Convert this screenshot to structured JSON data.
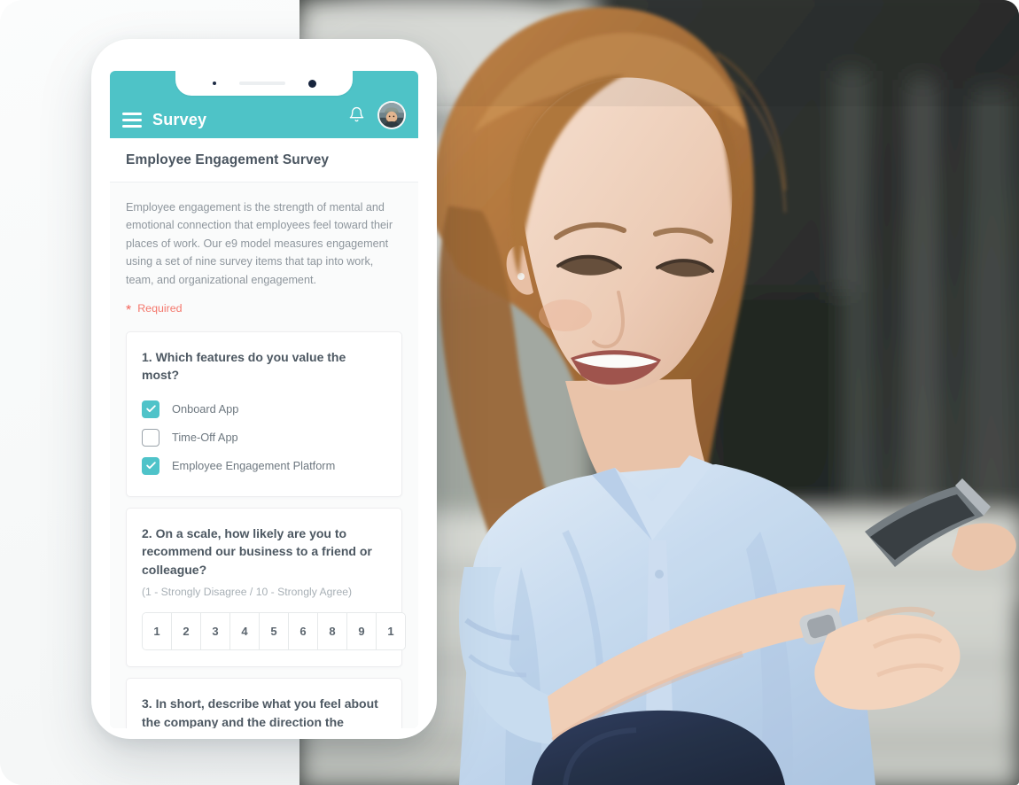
{
  "app": {
    "title": "Survey",
    "menu_icon": "hamburger-menu-icon",
    "notification_icon": "bell-icon",
    "avatar_label": "User avatar",
    "accent_color": "#4EC3C7",
    "required_color": "#F4776C"
  },
  "survey": {
    "title": "Employee Engagement Survey",
    "description": "Employee engagement is the strength of mental and emotional connection that employees feel toward their places of work. Our e9 model measures engagement using a set of nine survey items that tap into work, team, and organizational engagement.",
    "required_star": "*",
    "required_label": "Required"
  },
  "questions": [
    {
      "title": "1. Which features do you value the most?",
      "type": "checkbox",
      "options": [
        {
          "label": "Onboard App",
          "checked": true
        },
        {
          "label": "Time-Off App",
          "checked": false
        },
        {
          "label": "Employee Engagement Platform",
          "checked": true
        }
      ]
    },
    {
      "title": "2. On a scale, how likely are you to recommend our business to a friend or colleague?",
      "type": "scale",
      "hint": "(1 -  Strongly Disagree / 10 - Strongly Agree)",
      "scale_values": [
        "1",
        "2",
        "3",
        "4",
        "5",
        "6",
        "8",
        "9",
        "1"
      ]
    },
    {
      "title": "3. In short, describe what you feel about the company and the direction the",
      "type": "text"
    }
  ],
  "photo": {
    "alt": "Smiling red-haired woman in a light blue shirt using a smartphone outside an office building",
    "shirt_color": "#BFD6EC",
    "hair_color": "#A4682F",
    "trousers_color": "#1C2A44",
    "background_color": "#2E322F"
  }
}
